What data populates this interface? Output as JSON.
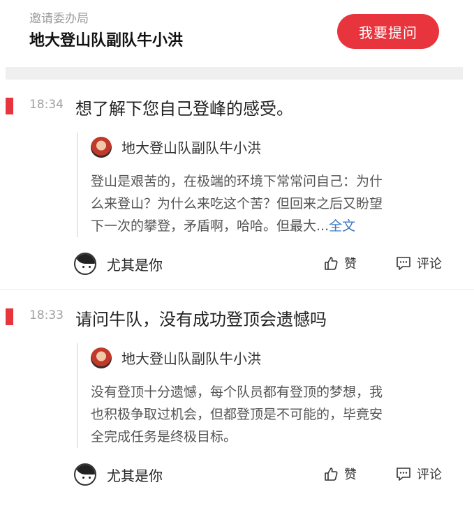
{
  "header": {
    "inviter": "邀请委办局",
    "host_name": "地大登山队副队牛小洪",
    "ask_button": "我要提问"
  },
  "items": [
    {
      "time": "18:34",
      "question": "想了解下您自己登峰的感受。",
      "answerer": "地大登山队副队牛小洪",
      "answer_lines": [
        "登山是艰苦的，在极端的环境下常常问自己：为什",
        "么来登山？为什么来吃这个苦？但回来之后又盼望",
        "下一次的攀登，矛盾啊，哈哈。但最大..."
      ],
      "more_label": "全文",
      "asker": "尤其是你",
      "like_label": "赞",
      "comment_label": "评论"
    },
    {
      "time": "18:33",
      "question": "请问牛队，没有成功登顶会遗憾吗",
      "answerer": "地大登山队副队牛小洪",
      "answer_lines": [
        "没有登顶十分遗憾，每个队员都有登顶的梦想，我",
        "也积极争取过机会，但都登顶是不可能的，毕竟安",
        "全完成任务是终极目标。"
      ],
      "asker": "尤其是你",
      "like_label": "赞",
      "comment_label": "评论"
    }
  ],
  "colors": {
    "accent": "#e8343c",
    "link": "#3b78c3",
    "band": "#efefef"
  },
  "icons": {
    "like": "thumbs-up-icon",
    "comment": "comment-icon"
  }
}
